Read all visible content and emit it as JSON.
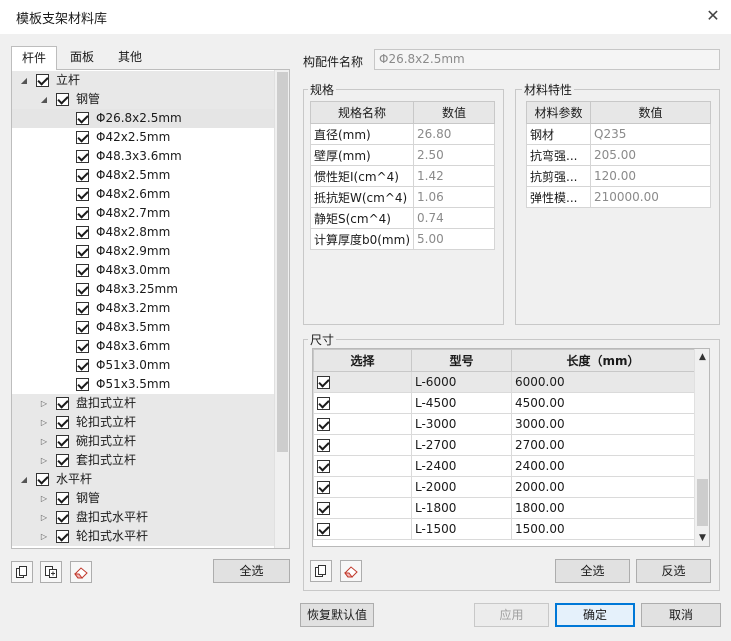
{
  "window": {
    "title": "模板支架材料库"
  },
  "tabs": [
    "杆件",
    "面板",
    "其他"
  ],
  "tree": {
    "vertical_rod": "立杆",
    "steel_pipe": "钢管",
    "pipes": [
      "Φ26.8x2.5mm",
      "Φ42x2.5mm",
      "Φ48.3x3.6mm",
      "Φ48x2.5mm",
      "Φ48x2.6mm",
      "Φ48x2.7mm",
      "Φ48x2.8mm",
      "Φ48x2.9mm",
      "Φ48x3.0mm",
      "Φ48x3.25mm",
      "Φ48x3.2mm",
      "Φ48x3.5mm",
      "Φ48x3.6mm",
      "Φ51x3.0mm",
      "Φ51x3.5mm"
    ],
    "vertical_types": [
      "盘扣式立杆",
      "轮扣式立杆",
      "碗扣式立杆",
      "套扣式立杆"
    ],
    "horizontal_rod": "水平杆",
    "horizontal_types": [
      "钢管",
      "盘扣式水平杆",
      "轮扣式水平杆"
    ]
  },
  "left_toolbar": {
    "select_all": "全选"
  },
  "component": {
    "label": "构配件名称",
    "value": "Φ26.8x2.5mm"
  },
  "spec": {
    "title": "规格",
    "headers": [
      "规格名称",
      "数值"
    ],
    "rows": [
      [
        "直径(mm)",
        "26.80"
      ],
      [
        "壁厚(mm)",
        "2.50"
      ],
      [
        "惯性矩I(cm^4)",
        "1.42"
      ],
      [
        "抵抗矩W(cm^4)",
        "1.06"
      ],
      [
        "静矩S(cm^4)",
        "0.74"
      ],
      [
        "计算厚度b0(mm)",
        "5.00"
      ]
    ]
  },
  "material": {
    "title": "材料特性",
    "headers": [
      "材料参数",
      "数值"
    ],
    "rows": [
      [
        "钢材",
        "Q235"
      ],
      [
        "抗弯强...",
        "205.00"
      ],
      [
        "抗剪强...",
        "120.00"
      ],
      [
        "弹性模...",
        "210000.00"
      ]
    ]
  },
  "size": {
    "title": "尺寸",
    "headers": [
      "选择",
      "型号",
      "长度（mm）"
    ],
    "rows": [
      [
        "L-6000",
        "6000.00"
      ],
      [
        "L-4500",
        "4500.00"
      ],
      [
        "L-3000",
        "3000.00"
      ],
      [
        "L-2700",
        "2700.00"
      ],
      [
        "L-2400",
        "2400.00"
      ],
      [
        "L-2000",
        "2000.00"
      ],
      [
        "L-1800",
        "1800.00"
      ],
      [
        "L-1500",
        "1500.00"
      ]
    ],
    "select_all": "全选",
    "invert": "反选"
  },
  "footer": {
    "restore": "恢复默认值",
    "apply": "应用",
    "ok": "确定",
    "cancel": "取消"
  },
  "icons": {
    "copy": "copy-icon",
    "paste": "paste-icon",
    "eraser": "eraser-icon"
  }
}
